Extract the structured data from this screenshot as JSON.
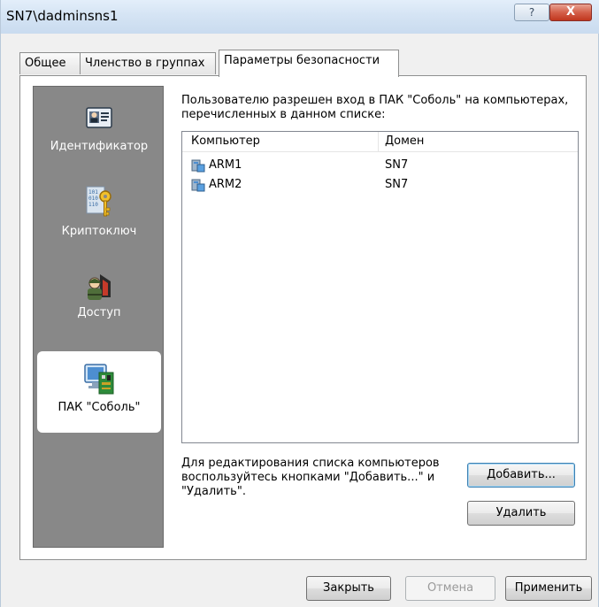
{
  "window": {
    "title": "SN7\\dadminsns1",
    "help_label": "?",
    "close_label": "X"
  },
  "tabs": [
    {
      "label": "Общее"
    },
    {
      "label": "Членство в группах"
    },
    {
      "label": "Параметры безопасности"
    }
  ],
  "nav": {
    "items": [
      {
        "label": "Идентификатор",
        "icon": "id-card-icon"
      },
      {
        "label": "Криптоключ",
        "icon": "crypto-key-icon"
      },
      {
        "label": "Доступ",
        "icon": "access-icon"
      },
      {
        "label": "ПАК \"Соболь\"",
        "icon": "sobol-icon"
      }
    ]
  },
  "content": {
    "description": "Пользователю разрешен вход в ПАК \"Соболь\" на компьютерах, перечисленных в данном списке:",
    "columns": [
      "Компьютер",
      "Домен"
    ],
    "rows": [
      {
        "computer": "ARM1",
        "domain": "SN7"
      },
      {
        "computer": "ARM2",
        "domain": "SN7"
      }
    ],
    "hint": "Для редактирования списка компьютеров воспользуйтесь кнопками \"Добавить...\" и \"Удалить\".",
    "add_label": "Добавить...",
    "remove_label": "Удалить"
  },
  "footer": {
    "close_label": "Закрыть",
    "cancel_label": "Отмена",
    "apply_label": "Применить"
  }
}
